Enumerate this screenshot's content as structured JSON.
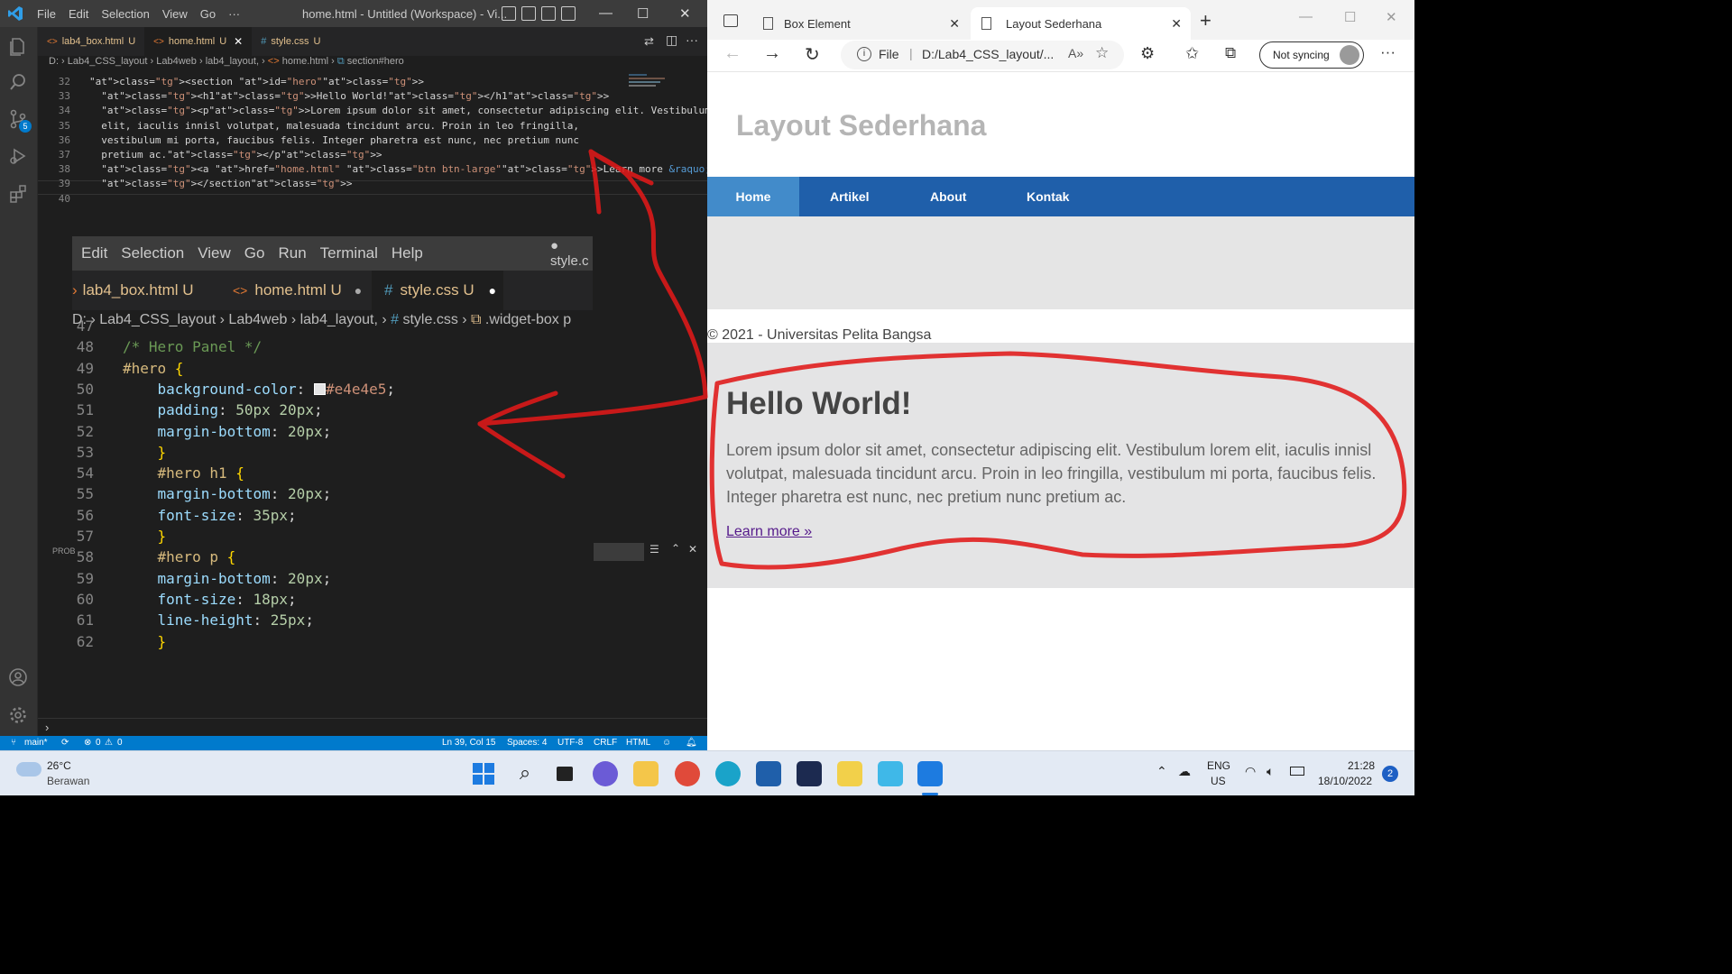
{
  "vscode": {
    "menu": [
      "File",
      "Edit",
      "Selection",
      "View",
      "Go",
      "···"
    ],
    "window_title": "home.html - Untitled (Workspace) - Vi...",
    "tabs": [
      {
        "label": "lab4_box.html",
        "status": "U"
      },
      {
        "label": "home.html",
        "status": "U"
      },
      {
        "label": "style.css",
        "status": "U"
      }
    ],
    "breadcrumb": [
      "D:",
      "Lab4_CSS_layout",
      "Lab4web",
      "lab4_layout,",
      "home.html",
      "section#hero"
    ],
    "source_control_badge": "5",
    "code_lines": [
      {
        "n": "32",
        "t": "<section id=\"hero\">"
      },
      {
        "n": "33",
        "t": "  <h1>Hello World!</h1>"
      },
      {
        "n": "34",
        "t": "  <p>Lorem ipsum dolor sit amet, consectetur adipiscing elit. Vestibulum lorem"
      },
      {
        "n": "35",
        "t": "  elit, iaculis innisl volutpat, malesuada tincidunt arcu. Proin in leo fringilla,"
      },
      {
        "n": "36",
        "t": "  vestibulum mi porta, faucibus felis. Integer pharetra est nunc, nec pretium nunc"
      },
      {
        "n": "37",
        "t": "  pretium ac.</p>"
      },
      {
        "n": "38",
        "t": "  <a href=\"home.html\" class=\"btn btn-large\">Learn more &raquo;</a>"
      },
      {
        "n": "39",
        "t": "  </section>"
      },
      {
        "n": "40",
        "t": ""
      }
    ],
    "zoom": {
      "menu": [
        "Edit",
        "Selection",
        "View",
        "Go",
        "Run",
        "Terminal",
        "Help"
      ],
      "menu_right": "● style.c",
      "tabs": [
        {
          "label": "lab4_box.html",
          "status": "U"
        },
        {
          "label": "home.html",
          "status": "U"
        },
        {
          "label": "style.css",
          "status": "U"
        }
      ],
      "breadcrumb": [
        "D:",
        "Lab4_CSS_layout",
        "Lab4web",
        "lab4_layout,",
        "#",
        "style.css",
        ".widget-box p"
      ],
      "lines": [
        {
          "n": "47",
          "t": ""
        },
        {
          "n": "48",
          "t": "/* Hero Panel */"
        },
        {
          "n": "49",
          "t": "#hero {"
        },
        {
          "n": "50",
          "t": "    background-color:   #e4e4e5;"
        },
        {
          "n": "51",
          "t": "    padding: 50px 20px;"
        },
        {
          "n": "52",
          "t": "    margin-bottom: 20px;"
        },
        {
          "n": "53",
          "t": "    }"
        },
        {
          "n": "54",
          "t": "    #hero h1 {"
        },
        {
          "n": "55",
          "t": "    margin-bottom: 20px;"
        },
        {
          "n": "56",
          "t": "    font-size: 35px;"
        },
        {
          "n": "57",
          "t": "    }"
        },
        {
          "n": "58",
          "t": "    #hero p {"
        },
        {
          "n": "59",
          "t": "    margin-bottom: 20px;"
        },
        {
          "n": "60",
          "t": "    font-size: 18px;"
        },
        {
          "n": "61",
          "t": "    line-height: 25px;"
        },
        {
          "n": "62",
          "t": "    }"
        }
      ],
      "swatch_color": "#e4e4e5"
    },
    "panel_label": "PROB",
    "status": {
      "branch": "main*",
      "errors": "0",
      "warnings": "0",
      "position": "Ln 39, Col 15",
      "spaces": "Spaces: 4",
      "encoding": "UTF-8",
      "eol": "CRLF",
      "language": "HTML"
    }
  },
  "edge": {
    "tabs": [
      {
        "label": "Box Element"
      },
      {
        "label": "Layout Sederhana"
      }
    ],
    "address_prefix": "File",
    "address": "D:/Lab4_CSS_layout/...",
    "sync_label": "Not syncing",
    "page": {
      "header": "Layout Sederhana",
      "nav": [
        "Home",
        "Artikel",
        "About",
        "Kontak"
      ],
      "footer": "© 2021 - Universitas Pelita Bangsa",
      "hero_title": "Hello World!",
      "hero_text": "Lorem ipsum dolor sit amet, consectetur adipiscing elit. Vestibulum lorem elit, iaculis innisl volutpat, malesuada tincidunt arcu. Proin in leo fringilla, vestibulum mi porta, faucibus felis. Integer pharetra est nunc, nec pretium nunc pretium ac.",
      "hero_link": "Learn more »"
    }
  },
  "taskbar": {
    "weather_temp": "26°C",
    "weather_desc": "Berawan",
    "lang": "ENG",
    "region": "US",
    "time": "21:28",
    "date": "18/10/2022",
    "notifications": "2"
  },
  "colors": {
    "vscode_status": "#007acc",
    "nav_bar": "#1f5faa",
    "hero_bg": "#e4e4e5",
    "annotation": "#e01919"
  }
}
